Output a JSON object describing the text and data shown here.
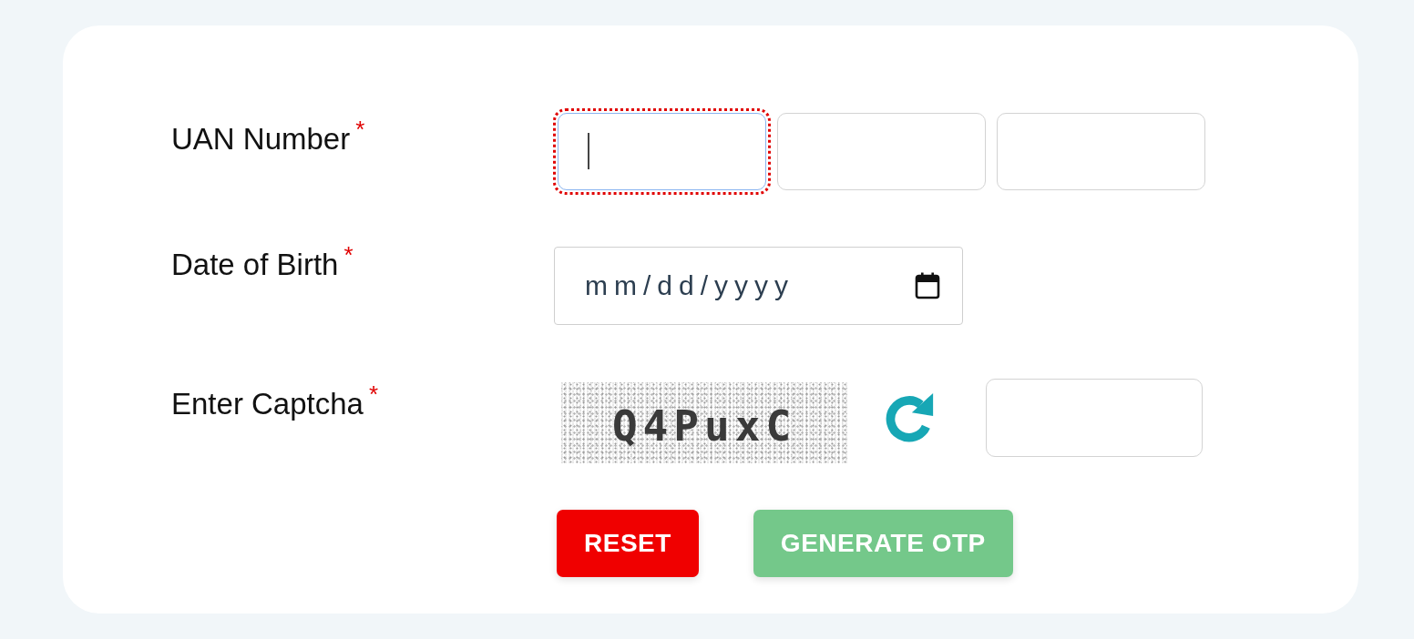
{
  "form": {
    "fields": [
      {
        "kind": "split",
        "label": "UAN Number",
        "required_mark": "*",
        "inputs": [
          {
            "focused": true
          },
          {
            "focused": false
          },
          {
            "focused": false
          }
        ]
      },
      {
        "kind": "date",
        "label": "Date of Birth",
        "required_mark": "*",
        "placeholder": "mm/dd/yyyy"
      },
      {
        "kind": "captcha",
        "label": "Enter Captcha",
        "required_mark": "*",
        "captcha_text": "Q4PuxC"
      }
    ],
    "buttons": [
      {
        "kind": "reset",
        "label": "RESET",
        "disabled": false
      },
      {
        "kind": "submit",
        "label": "GENERATE OTP",
        "disabled": true
      }
    ]
  }
}
